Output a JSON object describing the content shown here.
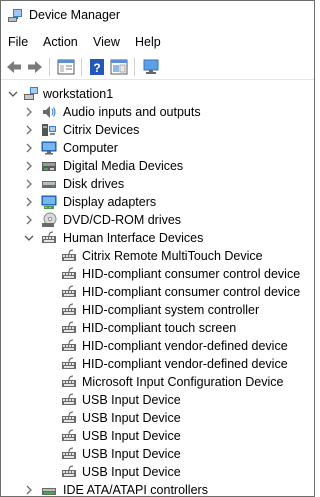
{
  "window": {
    "title": "Device Manager"
  },
  "menu": {
    "items": [
      "File",
      "Action",
      "View",
      "Help"
    ]
  },
  "toolbar": {
    "buttons": [
      "back-icon",
      "forward-icon",
      "properties-panel-icon",
      "help-icon",
      "show-hide-icon",
      "monitor-icon"
    ]
  },
  "tree": {
    "root": {
      "label": "workstation1",
      "expanded": true
    },
    "categories": [
      {
        "label": "Audio inputs and outputs",
        "icon": "speaker-icon",
        "expanded": false
      },
      {
        "label": "Citrix Devices",
        "icon": "citrix-device-icon",
        "expanded": false
      },
      {
        "label": "Computer",
        "icon": "computer-icon",
        "expanded": false
      },
      {
        "label": "Digital Media Devices",
        "icon": "media-device-icon",
        "expanded": false
      },
      {
        "label": "Disk drives",
        "icon": "disk-drive-icon",
        "expanded": false
      },
      {
        "label": "Display adapters",
        "icon": "display-adapter-icon",
        "expanded": false
      },
      {
        "label": "DVD/CD-ROM drives",
        "icon": "dvd-drive-icon",
        "expanded": false
      },
      {
        "label": "Human Interface Devices",
        "icon": "hid-icon",
        "expanded": true
      }
    ],
    "hid_children": [
      "Citrix Remote MultiTouch Device",
      "HID-compliant consumer control device",
      "HID-compliant consumer control device",
      "HID-compliant system controller",
      "HID-compliant touch screen",
      "HID-compliant vendor-defined device",
      "HID-compliant vendor-defined device",
      "Microsoft Input Configuration Device",
      "USB Input Device",
      "USB Input Device",
      "USB Input Device",
      "USB Input Device",
      "USB Input Device"
    ],
    "after": [
      {
        "label": "IDE ATA/ATAPI controllers",
        "icon": "ide-controller-icon",
        "expanded": false
      }
    ]
  },
  "colors": {
    "accent": "#1e73be",
    "expander": "#6e6e6e"
  }
}
